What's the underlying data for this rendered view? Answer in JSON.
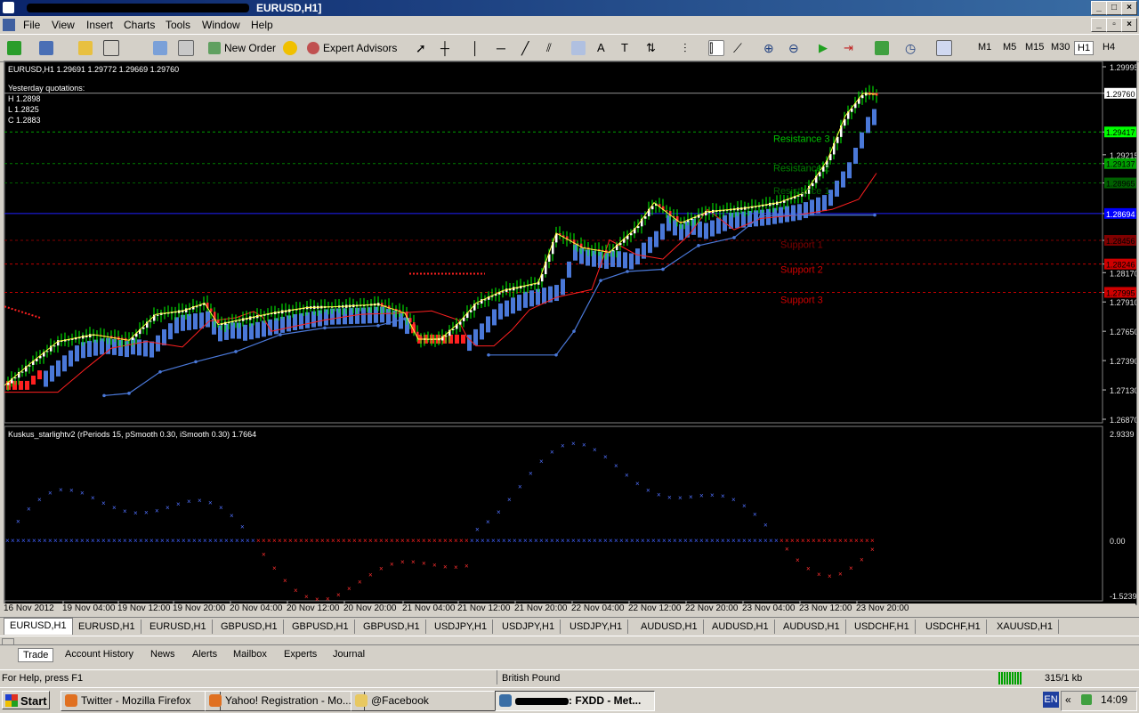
{
  "window": {
    "title": "EURUSD,H1]"
  },
  "menu": [
    "File",
    "View",
    "Insert",
    "Charts",
    "Tools",
    "Window",
    "Help"
  ],
  "toolbar": {
    "new_order": "New Order",
    "expert_advisors": "Expert Advisors",
    "timeframes": [
      "M1",
      "M5",
      "M15",
      "M30",
      "H1",
      "H4"
    ],
    "active_timeframe": "H1"
  },
  "chart": {
    "header": "EURUSD,H1  1.29691 1.29772 1.29669 1.29760",
    "quotes_title": "Yesterday quotations:",
    "quotes": [
      "H 1.2898",
      "L 1.2825",
      "C 1.2883"
    ],
    "levels": [
      {
        "label": "Resistance 3",
        "color": "#00c000"
      },
      {
        "label": "Resistance 2",
        "color": "#008000"
      },
      {
        "label": "Resistance 1",
        "color": "#006000"
      },
      {
        "label": "Support 1",
        "color": "#800000"
      },
      {
        "label": "Support 2",
        "color": "#d00000"
      },
      {
        "label": "Support 3",
        "color": "#d00000"
      }
    ],
    "price_scale": [
      "1.29995",
      "1.29760",
      "1.29417",
      "1.29215",
      "1.29137",
      "1.28965",
      "1.28694",
      "1.28456",
      "1.28246",
      "1.28170",
      "1.27995",
      "1.27910",
      "1.27650",
      "1.27390",
      "1.27130",
      "1.26870"
    ],
    "price_scale_badges": [
      {
        "text": "1.29760",
        "fg": "#000000",
        "bg": "#ffffff"
      },
      {
        "text": "1.29417",
        "fg": "#000000",
        "bg": "#00ff00"
      },
      {
        "text": "1.29137",
        "fg": "#000000",
        "bg": "#00a000"
      },
      {
        "text": "1.28965",
        "fg": "#000000",
        "bg": "#006000"
      },
      {
        "text": "1.28694",
        "fg": "#ffffff",
        "bg": "#0000ff"
      },
      {
        "text": "1.28456",
        "fg": "#000000",
        "bg": "#800000"
      },
      {
        "text": "1.28246",
        "fg": "#000000",
        "bg": "#d00000"
      },
      {
        "text": "1.27995",
        "fg": "#000000",
        "bg": "#d00000"
      }
    ],
    "indicator_header": "Kuskus_starlightv2  (rPeriods 15, pSmooth 0.30, iSmooth 0.30)   1.7664",
    "indicator_scale": [
      "2.9339",
      "0.00",
      "-1.5239"
    ],
    "time_axis": [
      "16 Nov 2012",
      "19 Nov 04:00",
      "19 Nov 12:00",
      "19 Nov 20:00",
      "20 Nov 04:00",
      "20 Nov 12:00",
      "20 Nov 20:00",
      "21 Nov 04:00",
      "21 Nov 12:00",
      "21 Nov 20:00",
      "22 Nov 04:00",
      "22 Nov 12:00",
      "22 Nov 20:00",
      "23 Nov 04:00",
      "23 Nov 12:00",
      "23 Nov 20:00"
    ]
  },
  "symbol_tabs": [
    "EURUSD,H1",
    "EURUSD,H1",
    "EURUSD,H1",
    "GBPUSD,H1",
    "GBPUSD,H1",
    "GBPUSD,H1",
    "USDJPY,H1",
    "USDJPY,H1",
    "USDJPY,H1",
    "AUDUSD,H1",
    "AUDUSD,H1",
    "AUDUSD,H1",
    "USDCHF,H1",
    "USDCHF,H1",
    "XAUUSD,H1"
  ],
  "terminal_tabs": [
    "Trade",
    "Account History",
    "News",
    "Alerts",
    "Mailbox",
    "Experts",
    "Journal"
  ],
  "status": {
    "help": "For Help, press F1",
    "profile": "British Pound",
    "traffic": "315/1 kb"
  },
  "taskbar": {
    "start": "Start",
    "tasks": [
      "Twitter - Mozilla Firefox",
      "Yahoo! Registration - Mo...",
      "@Facebook",
      ": FXDD - Met..."
    ],
    "lang": "EN",
    "clock": "14:09"
  }
}
